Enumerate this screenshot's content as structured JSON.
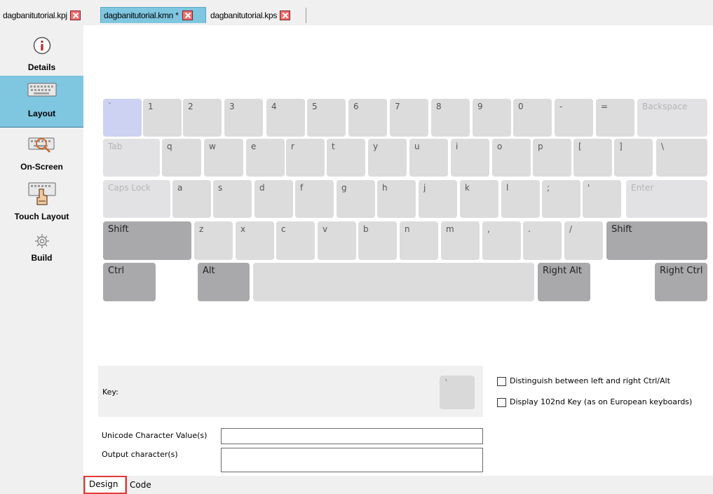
{
  "file_tabs": [
    {
      "label": "dagbanitutorial.kpj"
    },
    {
      "label": "dagbanitutorial.kmn *"
    },
    {
      "label": "dagbanitutorial.kps"
    }
  ],
  "sidebar": {
    "items": [
      {
        "label": "Details",
        "icon": "info-icon"
      },
      {
        "label": "Layout",
        "icon": "keyboard-icon"
      },
      {
        "label": "On-Screen",
        "icon": "onscreen-keyboard-icon"
      },
      {
        "label": "Touch Layout",
        "icon": "touch-keyboard-icon"
      },
      {
        "label": "Build",
        "icon": "gear-icon"
      }
    ]
  },
  "keyboard": {
    "row1": [
      "`",
      "1",
      "2",
      "3",
      "4",
      "5",
      "6",
      "7",
      "8",
      "9",
      "0",
      "-",
      "=",
      "Backspace"
    ],
    "row2": [
      "Tab",
      "q",
      "w",
      "e",
      "r",
      "t",
      "y",
      "u",
      "i",
      "o",
      "p",
      "[",
      "]",
      "\\"
    ],
    "row3": [
      "Caps Lock",
      "a",
      "s",
      "d",
      "f",
      "g",
      "h",
      "j",
      "k",
      "l",
      ";",
      "'",
      "Enter"
    ],
    "row4": [
      "Shift",
      "z",
      "x",
      "c",
      "v",
      "b",
      "n",
      "m",
      ",",
      ".",
      "/",
      "Shift"
    ],
    "row5": [
      "Ctrl",
      "Alt",
      "",
      "Right Alt",
      "Right Ctrl"
    ]
  },
  "key_panel": {
    "key_label": "Key:",
    "key_preview": "`"
  },
  "options": {
    "distinguish_ctrl_alt": {
      "label": "Distinguish between left and right Ctrl/Alt",
      "checked": false
    },
    "display_102nd": {
      "label": "Display 102nd Key (as on European keyboards)",
      "checked": false
    }
  },
  "fields": {
    "unicode_label": "Unicode Character Value(s)",
    "unicode_value": "",
    "output_label": "Output character(s)",
    "output_value": ""
  },
  "bottom_tabs": [
    {
      "label": "Design"
    },
    {
      "label": "Code"
    }
  ],
  "colors": {
    "active_tab": "#7fc6e0",
    "selected_key": "#cdd2f2",
    "modifier_key": "#a9a9ab",
    "highlight_box": "#e53935"
  }
}
